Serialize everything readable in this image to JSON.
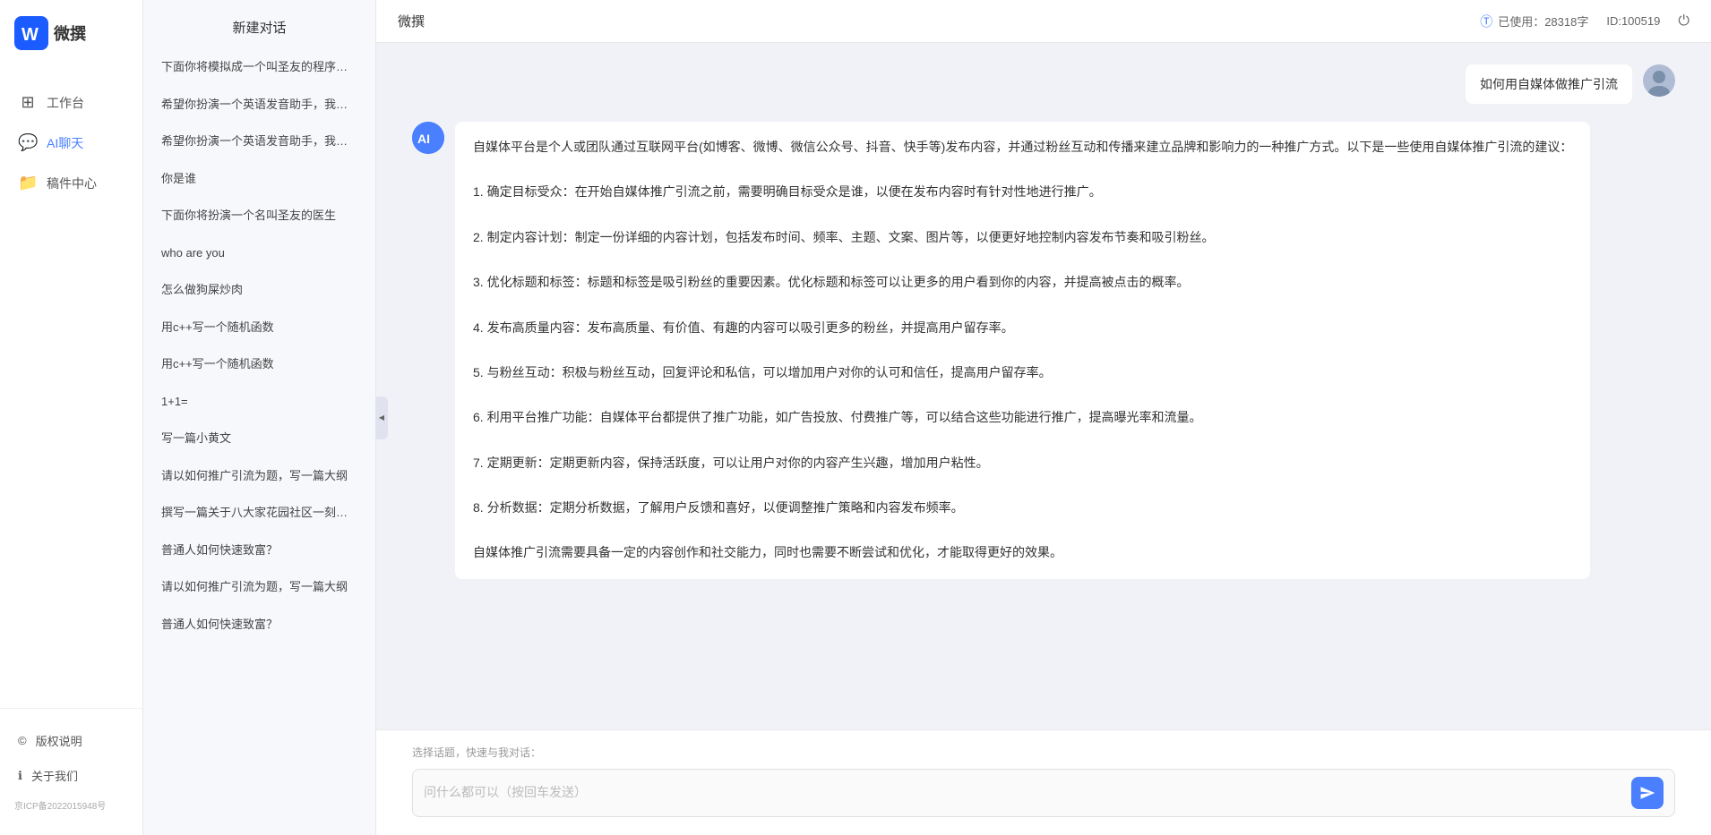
{
  "app": {
    "title": "微撰",
    "logo_letters": "W"
  },
  "top_bar": {
    "title": "微撰",
    "usage_label": "已使用：28318字",
    "id_label": "ID:100519",
    "usage_icon": "ℹ"
  },
  "nav": {
    "items": [
      {
        "id": "workbench",
        "label": "工作台",
        "icon": "⊞"
      },
      {
        "id": "ai-chat",
        "label": "AI聊天",
        "icon": "💬"
      },
      {
        "id": "mailbox",
        "label": "稿件中心",
        "icon": "📁"
      }
    ],
    "bottom": [
      {
        "id": "copyright",
        "label": "版权说明",
        "icon": "©"
      },
      {
        "id": "about",
        "label": "关于我们",
        "icon": "ℹ"
      }
    ],
    "icp": "京ICP备2022015948号"
  },
  "middle_panel": {
    "header": "新建对话",
    "conversations": [
      "下面你将模拟成一个叫圣友的程序员，我说...",
      "希望你扮演一个英语发音助手，我提供给你...",
      "希望你扮演一个英语发音助手，我提供给你...",
      "你是谁",
      "下面你将扮演一个名叫圣友的医生",
      "who are you",
      "怎么做狗屎炒肉",
      "用c++写一个随机函数",
      "用c++写一个随机函数",
      "1+1=",
      "写一篇小黄文",
      "请以如何推广引流为题，写一篇大纲",
      "撰写一篇关于八大家花园社区一刻钟便民生...",
      "普通人如何快速致富？",
      "请以如何推广引流为题，写一篇大纲",
      "普通人如何快速致富？"
    ]
  },
  "chat": {
    "user_message": "如何用自媒体做推广引流",
    "ai_response": {
      "paragraphs": [
        "自媒体平台是个人或团队通过互联网平台(如博客、微博、微信公众号、抖音、快手等)发布内容，并通过粉丝互动和传播来建立品牌和影响力的一种推广方式。以下是一些使用自媒体推广引流的建议：",
        "1. 确定目标受众：在开始自媒体推广引流之前，需要明确目标受众是谁，以便在发布内容时有针对性地进行推广。",
        "2. 制定内容计划：制定一份详细的内容计划，包括发布时间、频率、主题、文案、图片等，以便更好地控制内容发布节奏和吸引粉丝。",
        "3. 优化标题和标签：标题和标签是吸引粉丝的重要因素。优化标题和标签可以让更多的用户看到你的内容，并提高被点击的概率。",
        "4. 发布高质量内容：发布高质量、有价值、有趣的内容可以吸引更多的粉丝，并提高用户留存率。",
        "5. 与粉丝互动：积极与粉丝互动，回复评论和私信，可以增加用户对你的认可和信任，提高用户留存率。",
        "6. 利用平台推广功能：自媒体平台都提供了推广功能，如广告投放、付费推广等，可以结合这些功能进行推广，提高曝光率和流量。",
        "7. 定期更新：定期更新内容，保持活跃度，可以让用户对你的内容产生兴趣，增加用户粘性。",
        "8. 分析数据：定期分析数据，了解用户反馈和喜好，以便调整推广策略和内容发布频率。",
        "自媒体推广引流需要具备一定的内容创作和社交能力，同时也需要不断尝试和优化，才能取得更好的效果。"
      ]
    }
  },
  "input": {
    "quick_label": "选择话题，快速与我对话：",
    "placeholder": "问什么都可以（按回车发送）"
  }
}
